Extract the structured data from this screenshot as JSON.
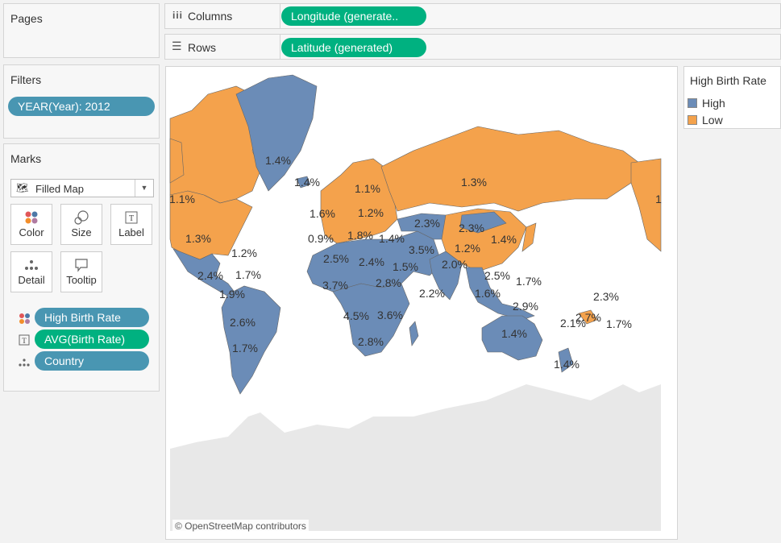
{
  "pages": {
    "title": "Pages"
  },
  "columns": {
    "label": "Columns",
    "pill": "Longitude (generate.."
  },
  "rows": {
    "label": "Rows",
    "pill": "Latitude (generated)"
  },
  "filters": {
    "title": "Filters",
    "pill": "YEAR(Year): 2012"
  },
  "marks": {
    "title": "Marks",
    "type_select": "Filled Map",
    "buttons": {
      "color": "Color",
      "size": "Size",
      "label": "Label",
      "detail": "Detail",
      "tooltip": "Tooltip"
    },
    "fields": [
      {
        "icon": "color-dots-icon",
        "label": "High Birth Rate"
      },
      {
        "icon": "label-text-icon",
        "label": "AVG(Birth Rate)"
      },
      {
        "icon": "detail-dots-icon",
        "label": "Country"
      }
    ]
  },
  "legend": {
    "title": "High Birth Rate",
    "items": [
      {
        "label": "High",
        "color": "#6b8cb7"
      },
      {
        "label": "Low",
        "color": "#f4a24c"
      }
    ]
  },
  "map": {
    "attribution": "© OpenStreetMap contributors",
    "colors": {
      "high": "#6b8cb7",
      "low": "#f4a24c",
      "antarctica": "#e8e8e8",
      "ocean": "#ffffff"
    },
    "labels": [
      "1.4%",
      "1.4%",
      "1.1%",
      "1.3%",
      "1.1%",
      "1.6%",
      "1.2%",
      "1.3%",
      "0.9%",
      "1.8%",
      "1.4%",
      "2.3%",
      "2.3%",
      "1.4%",
      "1.2%",
      "1.2%",
      "1.7%",
      "2.5%",
      "2.4%",
      "3.5%",
      "1.5%",
      "2.0%",
      "2.4%",
      "2.5%",
      "1.7%",
      "3.7%",
      "2.8%",
      "1.9%",
      "2.2%",
      "1.6%",
      "2.3%",
      "2.9%",
      "2.6%",
      "4.5%",
      "3.6%",
      "2.1%",
      "2.7%",
      "1.7%",
      "1.4%",
      "2.8%",
      "1.7%",
      "1.4%",
      "1"
    ]
  }
}
